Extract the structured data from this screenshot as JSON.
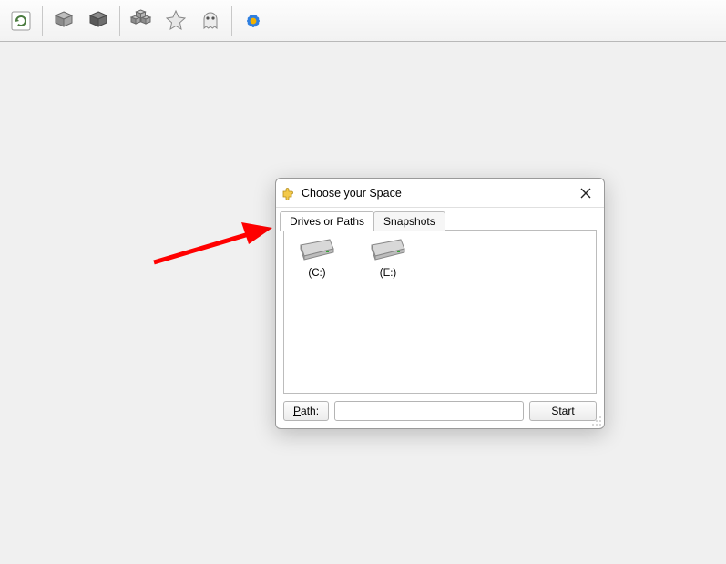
{
  "toolbar": {
    "items": [
      {
        "name": "refresh-icon"
      },
      {
        "name": "cube-icon"
      },
      {
        "name": "cube-dark-icon"
      },
      {
        "name": "cubes-icon"
      },
      {
        "name": "star-icon"
      },
      {
        "name": "ghost-icon"
      },
      {
        "name": "flower-icon"
      }
    ]
  },
  "dialog": {
    "title": "Choose your Space",
    "tabs": {
      "drives": "Drives or Paths",
      "snapshots": "Snapshots"
    },
    "drives": [
      {
        "label": "(C:)"
      },
      {
        "label": "(E:)"
      }
    ],
    "path_label": "Path:",
    "path_value": "",
    "start_label": "Start"
  }
}
